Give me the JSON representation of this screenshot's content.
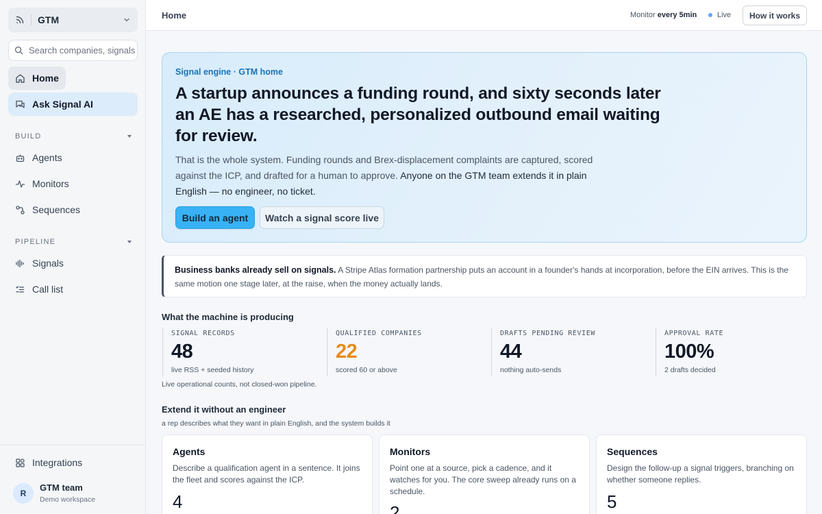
{
  "sidebar": {
    "workspace": "GTM",
    "search_placeholder": "Search companies, signals",
    "home": "Home",
    "ask_ai": "Ask Signal AI",
    "build_label": "BUILD",
    "build_items": [
      "Agents",
      "Monitors",
      "Sequences"
    ],
    "pipeline_label": "PIPELINE",
    "pipeline_items": [
      "Signals",
      "Call list"
    ],
    "integrations": "Integrations",
    "team": {
      "avatar": "R",
      "name": "GTM team",
      "sub": "Demo workspace"
    }
  },
  "topbar": {
    "breadcrumb": "Home",
    "monitor_prefix": "Monitor",
    "monitor_value": "every 5min",
    "live": "Live",
    "how_button": "How it works"
  },
  "hero": {
    "eyebrow": "Signal engine · GTM home",
    "headline": "A startup announces a funding round, and sixty seconds later an AE has a researched, personalized outbound email waiting for review.",
    "body": "That is the whole system. Funding rounds and Brex-displacement complaints are captured, scored against the ICP, and drafted for a human to approve.",
    "body_strong": "Anyone on the GTM team extends it in plain English — no engineer, no ticket.",
    "primary_button": "Build an agent",
    "secondary_button": "Watch a signal score live"
  },
  "callout": {
    "bold": "Business banks already sell on signals.",
    "text": "A Stripe Atlas formation partnership puts an account in a founder's hands at incorporation, before the EIN arrives. This is the same motion one stage later, at the raise, when the money actually lands."
  },
  "stats": {
    "title": "What the machine is producing",
    "note": "Live operational counts, not closed-won pipeline.",
    "items": [
      {
        "label": "SIGNAL RECORDS",
        "value": "48",
        "sub": "live RSS + seeded history"
      },
      {
        "label": "QUALIFIED COMPANIES",
        "value": "22",
        "sub": "scored 60 or above",
        "color": "#e88a1a"
      },
      {
        "label": "DRAFTS PENDING REVIEW",
        "value": "44",
        "sub": "nothing auto-sends"
      },
      {
        "label": "APPROVAL RATE",
        "value": "100%",
        "sub": "2 drafts decided"
      }
    ]
  },
  "extend": {
    "title": "Extend it without an engineer",
    "subtitle": "a rep describes what they want in plain English, and the system builds it",
    "cards": [
      {
        "title": "Agents",
        "desc": "Describe a qualification agent in a sentence. It joins the fleet and scores against the ICP.",
        "count": "4"
      },
      {
        "title": "Monitors",
        "desc": "Point one at a source, pick a cadence, and it watches for you. The core sweep already runs on a schedule.",
        "count": "2"
      },
      {
        "title": "Sequences",
        "desc": "Design the follow-up a signal triggers, branching on whether someone replies.",
        "count": "5"
      }
    ]
  }
}
